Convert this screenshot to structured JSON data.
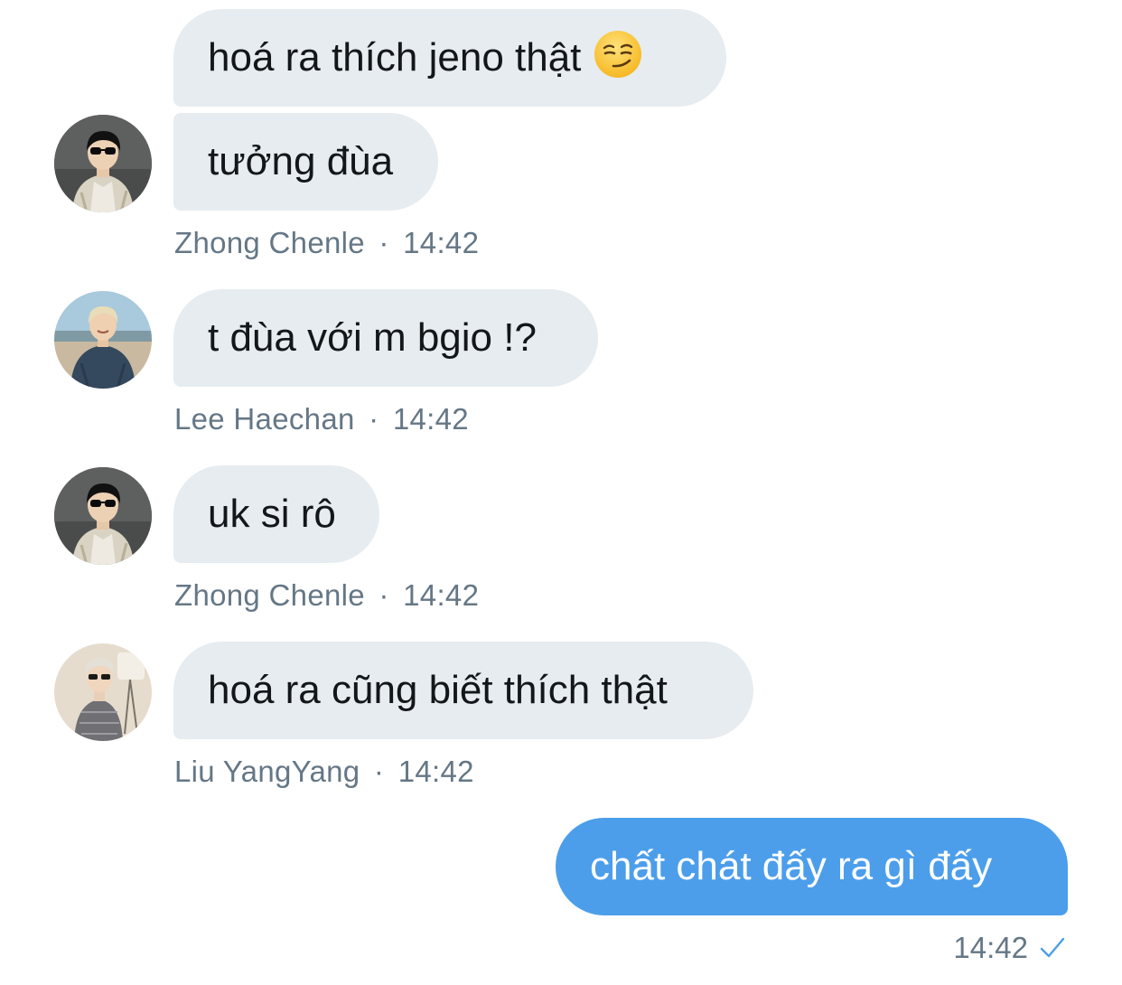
{
  "messages": [
    {
      "text": "hoá ra thích jeno thật",
      "emoji": "smirking-face-emoji"
    },
    {
      "text": "tưởng đùa"
    },
    {
      "text": "t đùa với m bgio !?"
    },
    {
      "text": "uk si rô"
    },
    {
      "text": "hoá ra cũng biết thích thật"
    },
    {
      "text": "chất chát đấy ra gì đấy"
    }
  ],
  "meta": [
    {
      "sender": "Zhong Chenle",
      "separator": "·",
      "time": "14:42"
    },
    {
      "sender": "Lee Haechan",
      "separator": "·",
      "time": "14:42"
    },
    {
      "sender": "Zhong Chenle",
      "separator": "·",
      "time": "14:42"
    },
    {
      "sender": "Liu YangYang",
      "separator": "·",
      "time": "14:42"
    }
  ],
  "outgoing_meta": {
    "time": "14:42",
    "status_icon": "check-icon"
  },
  "colors": {
    "incoming_bubble": "#e6ecf0",
    "outgoing_bubble": "#4c9eea",
    "meta_text": "#657786",
    "check": "#4c9eea"
  }
}
